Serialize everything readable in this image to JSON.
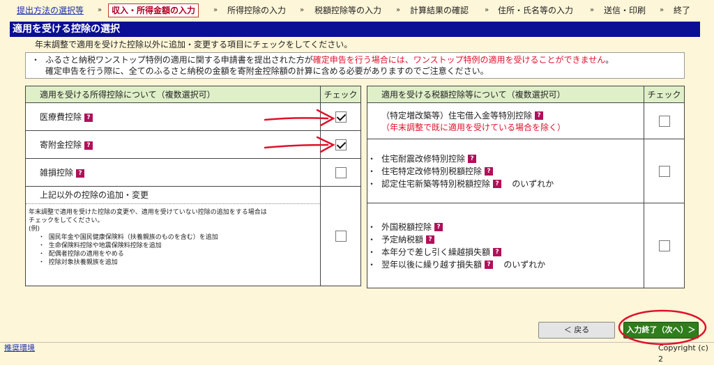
{
  "breadcrumb": {
    "step1": "提出方法の選択等",
    "step2": "収入・所得金額の入力",
    "step3": "所得控除の入力",
    "step4": "税額控除等の入力",
    "step5": "計算結果の確認",
    "step6": "住所・氏名等の入力",
    "step7": "送信・印刷",
    "step8": "終了",
    "arrow": "»"
  },
  "page_title": "適用を受ける控除の選択",
  "instruction": "年末調整で適用を受けた控除以外に追加・変更する項目にチェックをしてください。",
  "notice": {
    "bullet": "・",
    "line1_a": "ふるさと納税ワンストップ特例の適用に関する申請書を提出された方が",
    "line1_red": "確定申告を行う場合には、ワンストップ特例の適用を受けることができません",
    "line1_end": "。",
    "line2": "確定申告を行う際に、全てのふるさと納税の金額を寄附金控除額の計算に含める必要がありますのでご注意ください。"
  },
  "help_mark": "?",
  "left_table": {
    "header_name": "適用を受ける所得控除について（複数選択可）",
    "header_check": "チェック",
    "rows": [
      {
        "label": "医療費控除",
        "checked": true
      },
      {
        "label": "寄附金控除",
        "checked": true
      },
      {
        "label": "雑損控除",
        "checked": false
      }
    ],
    "other": {
      "title": "上記以外の控除の追加・変更",
      "desc1": "年末調整で適用を受けた控除の変更や、適用を受けていない控除の追加をする場合は",
      "desc2": "チェックをしてください。",
      "example": "(例)",
      "items": [
        "国民年金や国民健康保険料（扶養親族のものを含む）を追加",
        "生命保険料控除や地震保険料控除を追加",
        "配偶者控除の適用をやめる",
        "控除対象扶養親族を追加"
      ],
      "checked": false
    }
  },
  "right_table": {
    "header_name": "適用を受ける税額控除等について（複数選択可）",
    "header_check": "チェック",
    "housing_loan": {
      "label": "（特定増改築等）住宅借入金等特別控除",
      "note": "（年末調整で既に適用を受けている場合を除く）",
      "checked": false
    },
    "group2": {
      "items": [
        "住宅耐震改修特別控除",
        "住宅特定改修特別税額控除",
        "認定住宅新築等特別税額控除"
      ],
      "suffix": "のいずれか",
      "checked": false
    },
    "group3": {
      "items": [
        "外国税額控除",
        "予定納税額",
        "本年分で差し引く繰越損失額",
        "翌年以後に繰り越す損失額"
      ],
      "suffix": "のいずれか",
      "checked": false
    }
  },
  "buttons": {
    "back": "＜ 戻る",
    "next": "入力終了（次へ）＞"
  },
  "footer": {
    "env_link": "推奨環境",
    "copyright": "Copyright (c) 2"
  },
  "colors": {
    "title_bar": "#0a0f93",
    "header_bg": "#dff0c9",
    "accent_red": "#e0102a",
    "next_button": "#2f7d1c",
    "annotation": "#e0102a"
  }
}
